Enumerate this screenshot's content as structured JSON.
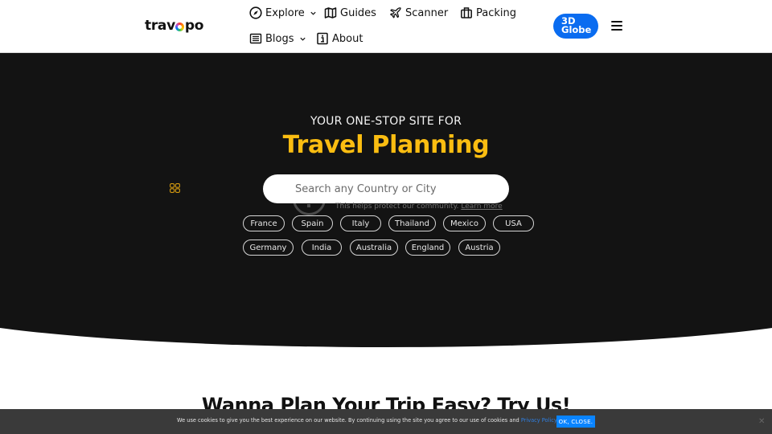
{
  "header": {
    "logo": {
      "prefix": "trav",
      "suffix": "po"
    },
    "nav": [
      {
        "label": "Explore",
        "icon": "compass-icon",
        "dropdown": true
      },
      {
        "label": "Guides",
        "icon": "map-icon",
        "dropdown": false
      },
      {
        "label": "Scanner",
        "icon": "plane-icon",
        "dropdown": false
      },
      {
        "label": "Packing",
        "icon": "luggage-icon",
        "dropdown": false
      },
      {
        "label": "Blogs",
        "icon": "news-icon",
        "dropdown": true
      },
      {
        "label": "About",
        "icon": "info-icon",
        "dropdown": false
      }
    ],
    "globe_button": {
      "line1": "3D",
      "line2": "Globe"
    },
    "menu_icon": "hamburger-icon"
  },
  "hero": {
    "tagline": "YOUR ONE-STOP SITE FOR",
    "headline": "Travel Planning",
    "search": {
      "placeholder": "Search any Country or City",
      "value": ""
    },
    "captcha": {
      "text": "This helps protect our community.",
      "link": "Learn more"
    },
    "chips_row1": [
      "France",
      "Spain",
      "Italy",
      "Thailand",
      "Mexico",
      "USA"
    ],
    "chips_row2": [
      "Germany",
      "India",
      "Australia",
      "England",
      "Austria"
    ]
  },
  "section": {
    "title": "Wanna Plan Your Trip Easy? Try Us!"
  },
  "cookie": {
    "text": "We use cookies to give you the best experience on our website. By continuing using the site you agree to our use of cookies and ",
    "link": "Privacy Policy",
    "after_link": ".",
    "ok_label": "OK, CLOSE.",
    "close_label": "✕"
  },
  "colors": {
    "accent_yellow": "#fbbd11",
    "globe_blue": "#0a6cf0",
    "hero_bg": "#131313",
    "cookie_bg": "#3a3a3a"
  }
}
